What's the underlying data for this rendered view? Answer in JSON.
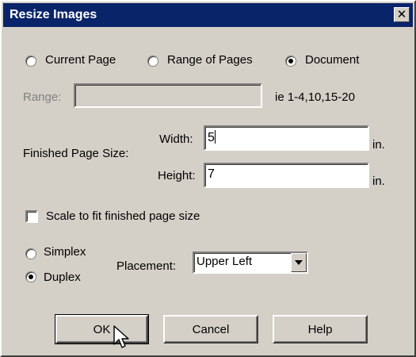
{
  "window": {
    "title": "Resize Images",
    "close_glyph": "✕"
  },
  "page_scope": {
    "options": [
      {
        "label": "Current Page",
        "selected": false
      },
      {
        "label": "Range of Pages",
        "selected": false
      },
      {
        "label": "Document",
        "selected": true
      }
    ]
  },
  "range": {
    "label": "Range:",
    "value": "",
    "hint": "ie 1-4,10,15-20"
  },
  "finished_page_size": {
    "label": "Finished Page Size:",
    "width_label": "Width:",
    "width_value": "5",
    "height_label": "Height:",
    "height_value": "7",
    "unit": "in."
  },
  "scale_to_fit": {
    "label": "Scale to fit finished page size",
    "checked": false
  },
  "sides": {
    "options": [
      {
        "label": "Simplex",
        "selected": false
      },
      {
        "label": "Duplex",
        "selected": true
      }
    ]
  },
  "placement": {
    "label": "Placement:",
    "selected": "Upper Left"
  },
  "buttons": {
    "ok": "OK",
    "cancel": "Cancel",
    "help": "Help"
  },
  "icons": {
    "close": "close-icon",
    "radio": "radio-icon",
    "checkbox": "checkbox-icon",
    "dropdown": "chevron-down-icon",
    "cursor": "mouse-pointer-icon"
  },
  "colors": {
    "titlebar": "#0a246a",
    "face": "#d4d0c8"
  }
}
